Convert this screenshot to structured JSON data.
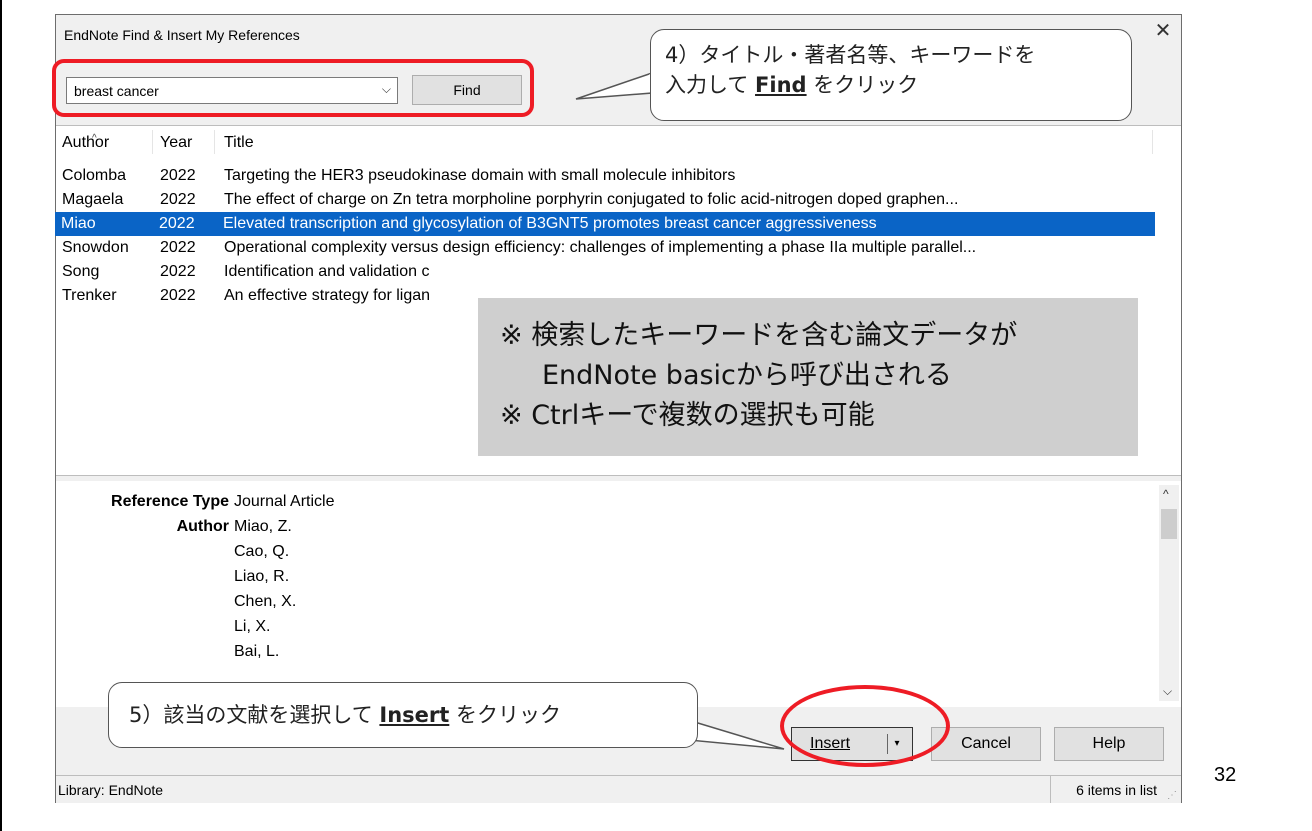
{
  "dialog": {
    "title": "EndNote Find & Insert My References",
    "close_icon": "close-icon"
  },
  "search": {
    "value": "breast cancer",
    "find_label": "Find"
  },
  "callout_find": {
    "line1": "4）タイトル・著者名等、キーワードを",
    "line2_prefix": "入力して ",
    "line2_bold": "Find",
    "line2_suffix": " をクリック"
  },
  "list": {
    "headers": {
      "author": "Author",
      "year": "Year",
      "title": "Title"
    },
    "rows": [
      {
        "author": "Colomba",
        "year": "2022",
        "title": "Targeting the HER3 pseudokinase domain with small molecule inhibitors",
        "selected": false
      },
      {
        "author": "Magaela",
        "year": "2022",
        "title": "The effect of charge on Zn tetra morpholine porphyrin conjugated to folic acid-nitrogen doped graphen...",
        "selected": false
      },
      {
        "author": "Miao",
        "year": "2022",
        "title": "Elevated transcription and glycosylation of B3GNT5 promotes breast cancer aggressiveness",
        "selected": true
      },
      {
        "author": "Snowdon",
        "year": "2022",
        "title": "Operational complexity versus design efficiency: challenges of implementing a phase IIa multiple parallel...",
        "selected": false
      },
      {
        "author": "Song",
        "year": "2022",
        "title": "Identification and validation c",
        "selected": false
      },
      {
        "author": "Trenker",
        "year": "2022",
        "title": "An effective strategy for ligan",
        "selected": false
      }
    ]
  },
  "overlay_note": {
    "line1": "※ 検索したキーワードを含む論文データが",
    "line2": "EndNote basicから呼び出される",
    "line3": "※ Ctrlキーで複数の選択も可能"
  },
  "detail": {
    "reference_type_label": "Reference Type",
    "reference_type_value": "Journal Article",
    "author_label": "Author",
    "authors": [
      "Miao, Z.",
      "Cao, Q.",
      "Liao, R.",
      "Chen, X.",
      "Li, X.",
      "Bai, L."
    ]
  },
  "callout_insert": {
    "prefix": "5）該当の文献を選択して ",
    "bold": "Insert",
    "suffix": " をクリック"
  },
  "buttons": {
    "insert": "Insert",
    "cancel": "Cancel",
    "help": "Help"
  },
  "status": {
    "library": "Library: EndNote",
    "count": "6 items in list"
  },
  "page_number": "32",
  "colors": {
    "selection": "#0a64c6",
    "highlight_red": "#ee1c25",
    "overlay_gray": "#cfcfcf"
  }
}
